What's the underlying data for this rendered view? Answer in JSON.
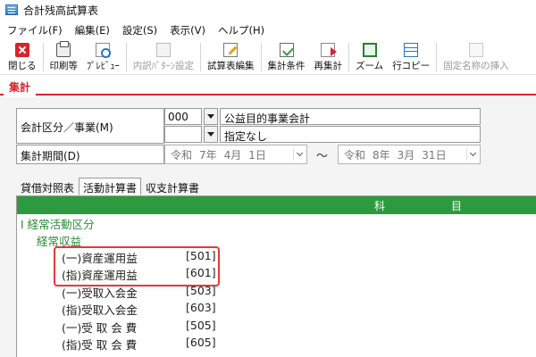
{
  "window": {
    "title": "合計残高試算表"
  },
  "menu": [
    "ファイル(F)",
    "編集(E)",
    "設定(S)",
    "表示(V)",
    "ヘルプ(H)"
  ],
  "toolbar": {
    "close": "閉じる",
    "print": "印刷等",
    "preview": "ﾌﾟﾚﾋﾞｭｰ",
    "detail_pattern": "内訳ﾊﾟﾀｰﾝ設定",
    "edit_sheet": "試算表編集",
    "conditions": "集計条件",
    "recalc": "再集計",
    "zoom": "ズーム",
    "row_copy": "行コピー",
    "fixed_name": "固定名称の挿入"
  },
  "main_tab": "集計",
  "form": {
    "division_label": "会計区分／事業(M)",
    "division_code": "000",
    "division_name": "公益目的事業会計",
    "business_code": "",
    "business_name": "指定なし",
    "period_label": "集計期間(D)",
    "period_from": {
      "era": "令和",
      "year": "7年",
      "month": "4月",
      "day": "1日"
    },
    "tilde": "～",
    "period_to": {
      "era": "令和",
      "year": "8年",
      "month": "3月",
      "day": "31日"
    }
  },
  "subtabs": [
    "貸借対照表",
    "活動計算書",
    "収支計算書"
  ],
  "report": {
    "header_left": "科",
    "header_right": "目",
    "section": "Ⅰ 経常活動区分",
    "subsection": "経常収益",
    "rows": [
      {
        "name": "(一)資産運用益",
        "code": "[501]"
      },
      {
        "name": "(指)資産運用益",
        "code": "[601]"
      },
      {
        "name": "(一)受取入会金",
        "code": "[503]"
      },
      {
        "name": "(指)受取入会金",
        "code": "[603]"
      },
      {
        "name": "(一)受 取 会 費",
        "code": "[505]"
      },
      {
        "name": "(指)受 取 会 費",
        "code": "[605]"
      }
    ]
  },
  "colors": {
    "accent_red": "#d9232d",
    "header_green": "#2e9a3f",
    "text_green": "#2c8b3a",
    "highlight": "#e53935"
  }
}
